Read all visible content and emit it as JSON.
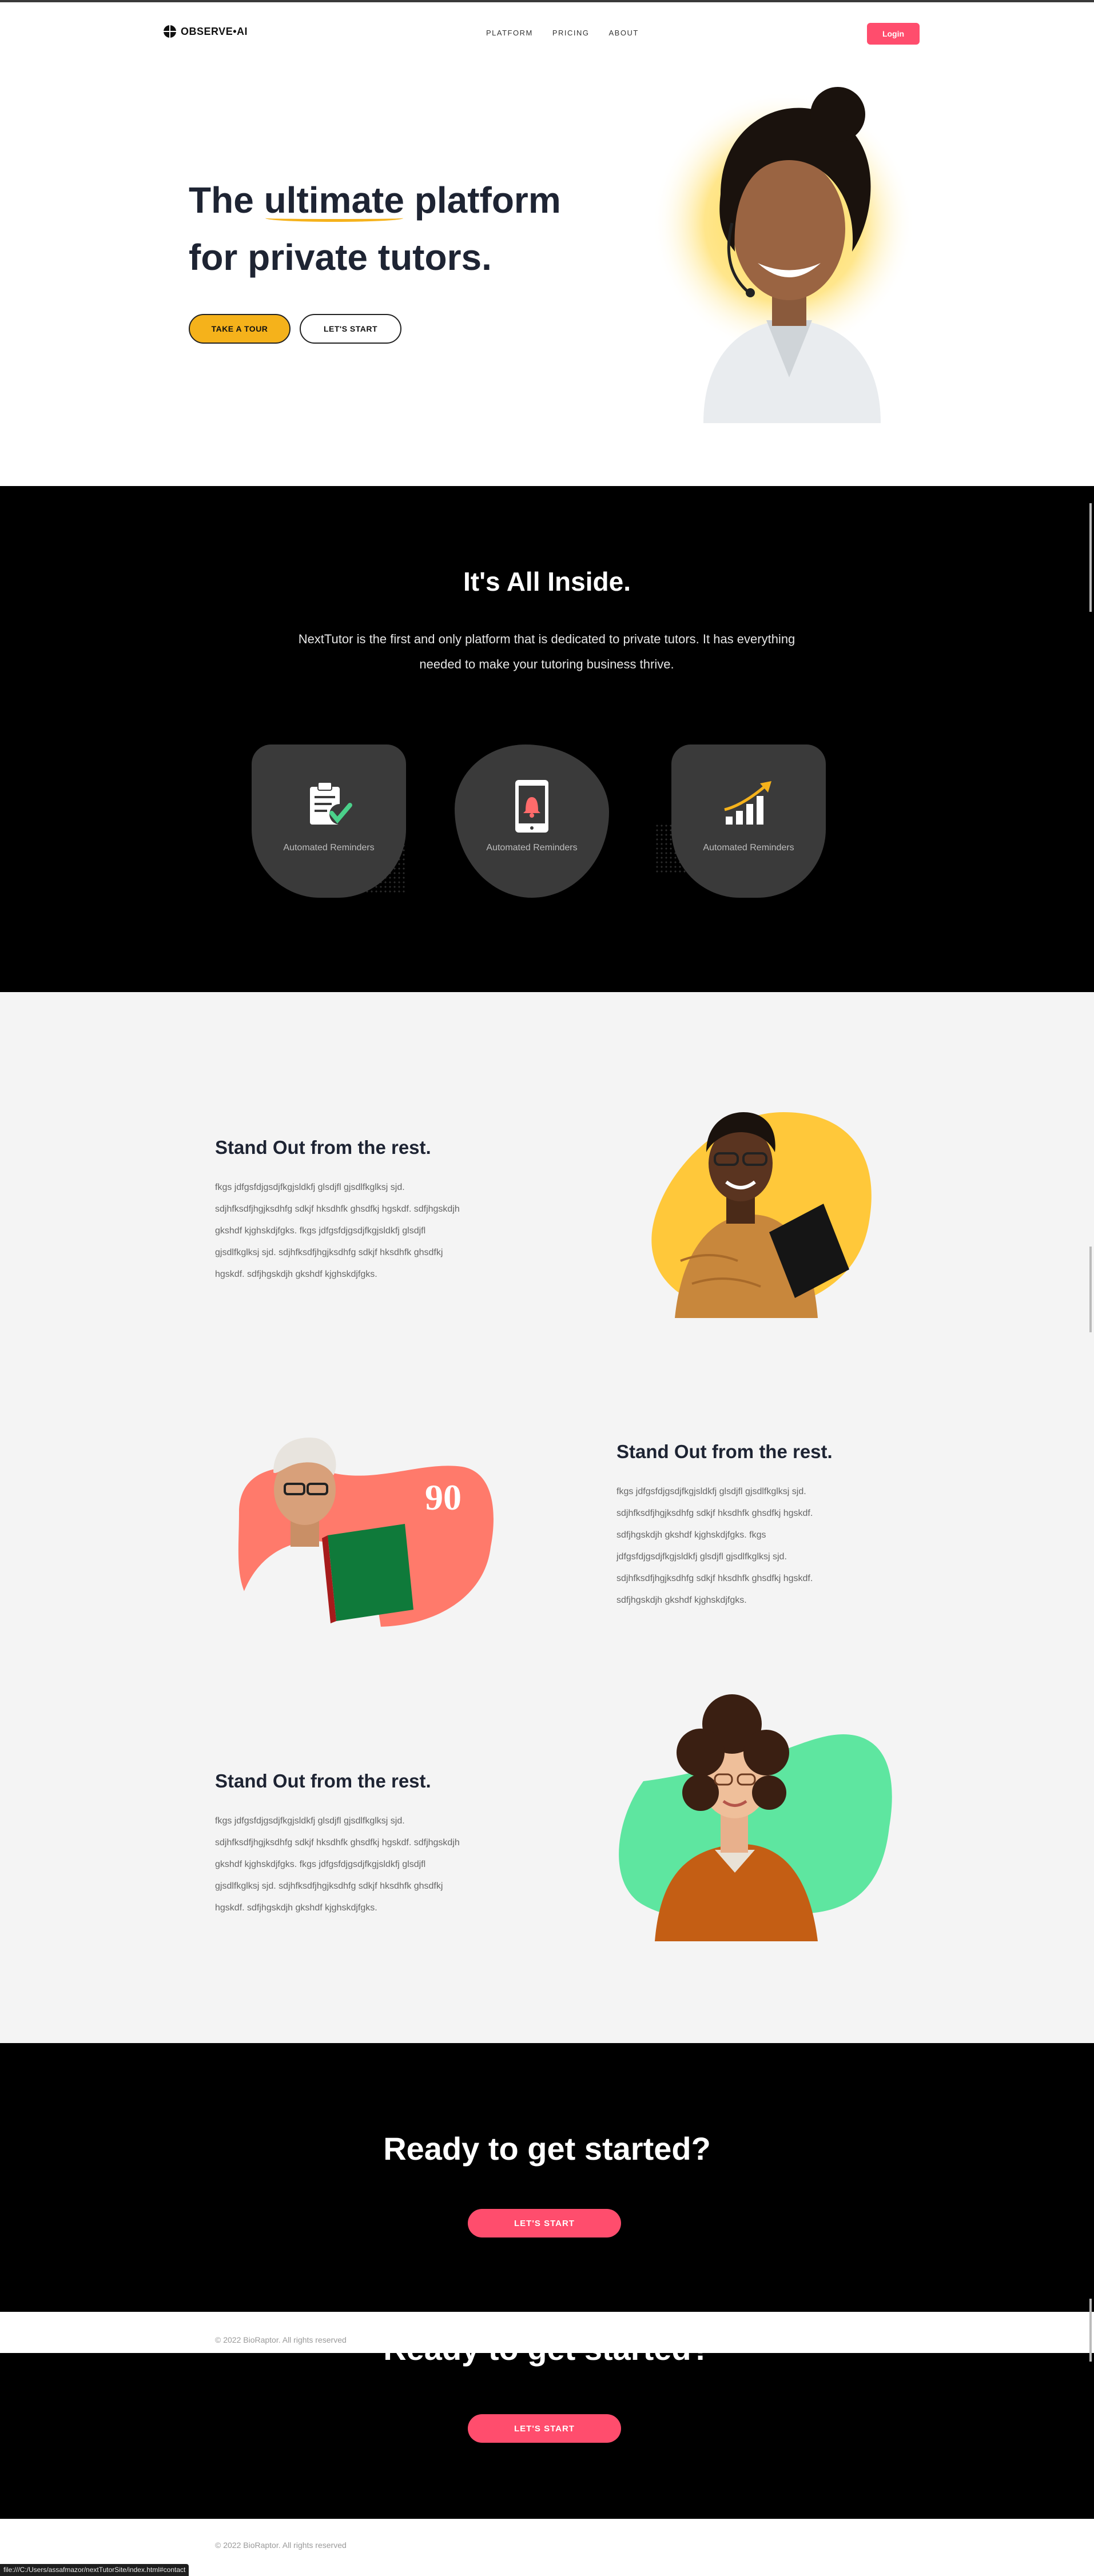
{
  "brand": {
    "name": "OBSERVE•AI"
  },
  "nav": {
    "links": [
      "PLATFORM",
      "PRICING",
      "ABOUT"
    ],
    "login": "Login"
  },
  "hero": {
    "title_pre": "The ",
    "title_highlight": "ultimate",
    "title_post": " platform",
    "title_line2": "for private tutors.",
    "primary_button": "TAKE A TOUR",
    "secondary_button": "LET'S START"
  },
  "inside": {
    "title": "It's All Inside.",
    "text": "NextTutor is the first and only platform that is dedicated to private tutors. It has everything needed to make your tutoring business thrive.",
    "cards": [
      {
        "label": "Automated Reminders",
        "icon": "clipboard-check-icon"
      },
      {
        "label": "Automated Reminders",
        "icon": "phone-bell-icon"
      },
      {
        "label": "Automated Reminders",
        "icon": "growth-chart-icon"
      }
    ]
  },
  "features": [
    {
      "title": "Stand Out from the rest.",
      "lines": [
        "fkgs jdfgsfdjgsdjfkgjsldkfj glsdjfl gjsdlfkglksj sjd.",
        "sdjhfksdfjhgjksdhfg sdkjf hksdhfk ghsdfkj hgskdf. sdfjhgskdjh",
        "gkshdf kjghskdjfgks. fkgs jdfgsfdjgsdjfkgjsldkfj glsdjfl",
        "gjsdlfkglksj sjd. sdjhfksdfjhgjksdhfg sdkjf hksdhfk ghsdfkj",
        "hgskdf. sdfjhgskdjh gkshdf kjghskdjfgks."
      ]
    },
    {
      "title": "Stand Out from the rest.",
      "lines": [
        "fkgs jdfgsfdjgsdjfkgjsldkfj glsdjfl gjsdlfkglksj sjd.",
        "sdjhfksdfjhgjksdhfg sdkjf hksdhfk ghsdfkj hgskdf.",
        "sdfjhgskdjh gkshdf kjghskdjfgks. fkgs",
        "jdfgsfdjgsdjfkgjsldkfj glsdjfl gjsdlfkglksj sjd.",
        "sdjhfksdfjhgjksdhfg sdkjf hksdhfk ghsdfkj hgskdf.",
        "sdfjhgskdjh gkshdf kjghskdjfgks."
      ],
      "photo_badge": "90"
    },
    {
      "title": "Stand Out from the rest.",
      "lines": [
        "fkgs jdfgsfdjgsdjfkgjsldkfj glsdjfl gjsdlfkglksj sjd.",
        "sdjhfksdfjhgjksdhfg sdkjf hksdhfk ghsdfkj hgskdf. sdfjhgskdjh",
        "gkshdf kjghskdjfgks. fkgs jdfgsfdjgsdjfkgjsldkfj glsdjfl",
        "gjsdlfkglksj sjd. sdjhfksdfjhgjksdhfg sdkjf hksdhfk ghsdfkj",
        "hgskdf. sdfjhgskdjh gkshdf kjghskdjfgks."
      ]
    }
  ],
  "cta": {
    "title": "Ready to get started?",
    "button": "LET'S START"
  },
  "footer": {
    "copyright": "© 2022 BioRaptor. All rights reserved"
  },
  "statusbar": {
    "url": "file:///C:/Users/assafmazor/nextTutorSite/index.html#contact"
  },
  "colors": {
    "accent_yellow": "#f5b21b",
    "accent_pink": "#ff4d6d",
    "dark": "#000000",
    "card": "#3a3a3a",
    "light_bg": "#f4f4f4"
  }
}
